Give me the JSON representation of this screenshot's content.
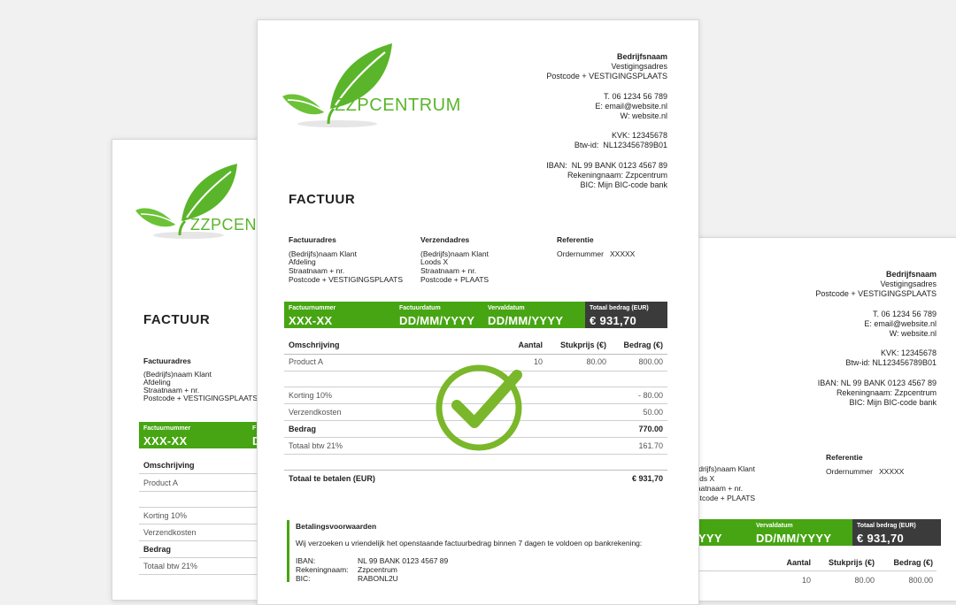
{
  "logo": {
    "brand": "ZZPCENTRUM"
  },
  "company": {
    "name": "Bedrijfsnaam",
    "address": "Vestigingsadres",
    "postal": "Postcode + VESTIGINGSPLAATS",
    "phone": "T. 06 1234 56 789",
    "email": "E: email@website.nl",
    "web": "W: website.nl",
    "kvk": "KVK: 12345678",
    "btw": "Btw-id:  NL123456789B01",
    "iban": "IBAN:  NL 99 BANK 0123 4567 89",
    "account_name": "Rekeningnaam: Zzpcentrum",
    "bic": "BIC: Mijn BIC-code bank"
  },
  "invoice": {
    "title": "FACTUUR",
    "billing": {
      "heading": "Factuuradres",
      "lines": [
        "(Bedrijfs)naam Klant",
        "Afdeling",
        "Straatnaam + nr.",
        "Postcode + VESTIGINGSPLAATS"
      ]
    },
    "shipping": {
      "heading": "Verzendadres",
      "lines": [
        "(Bedrijfs)naam Klant",
        "Loods X",
        "Straatnaam + nr.",
        "Postcode + PLAATS"
      ]
    },
    "reference": {
      "heading": "Referentie",
      "line": "Ordernummer   XXXXX"
    },
    "bar": {
      "number_label": "Factuurnummer",
      "number_value": "XXX-XX",
      "date_label": "Factuurdatum",
      "date_value": "DD/MM/YYYY",
      "due_label": "Vervaldatum",
      "due_value": "DD/MM/YYYY",
      "total_label": "Totaal bedrag (EUR)",
      "total_value": "€ 931,70"
    },
    "table": {
      "headers": {
        "desc": "Omschrijving",
        "qty": "Aantal",
        "unit": "Stukprijs (€)",
        "amount": "Bedrag (€)"
      },
      "item": {
        "desc": "Product A",
        "qty": "10",
        "unit": "80.00",
        "amount": "800.00"
      },
      "discount": {
        "label": "Korting 10%",
        "amount": "- 80.00"
      },
      "shipping": {
        "label": "Verzendkosten",
        "amount": "50.00"
      },
      "subtotal": {
        "label": "Bedrag",
        "amount": "770.00"
      },
      "vat": {
        "label": "Totaal btw 21%",
        "amount": "161.70"
      },
      "total": {
        "label": "Totaal te betalen (EUR)",
        "amount": "€ 931,70"
      }
    },
    "terms": {
      "heading": "Betalingsvoorwaarden",
      "text": "Wij verzoeken u vriendelijk het openstaande factuurbedrag binnen 7 dagen te voldoen op bankrekening:",
      "iban_label": "IBAN:",
      "iban_value": "NL 99 BANK 0123 4567 89",
      "name_label": "Rekeningnaam:",
      "name_value": "Zzpcentrum",
      "bic_label": "BIC:",
      "bic_value": "RABONL2U"
    }
  },
  "colors": {
    "accent_green": "#47a513",
    "dark_total": "#3b3b3b",
    "check_green": "#7ab72a"
  },
  "icons": {
    "center": "checkmark-circle-icon",
    "logo": "leaf-icon"
  }
}
